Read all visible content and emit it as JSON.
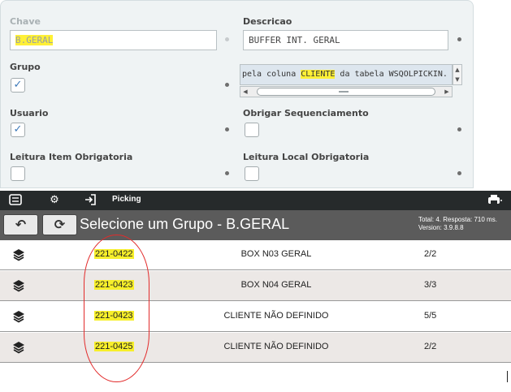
{
  "form": {
    "chave": {
      "label": "Chave",
      "value": "B.GERAL"
    },
    "descricao": {
      "label": "Descricao",
      "value": "BUFFER INT. GERAL"
    },
    "grupo": {
      "label": "Grupo",
      "checked": true
    },
    "memo": {
      "before": "pela coluna ",
      "highlight": "CLIENTE",
      "after": " da tabela WSQOLPICKIN."
    },
    "usuario": {
      "label": "Usuario",
      "checked": true
    },
    "obrigar_seq": {
      "label": "Obrigar Sequenciamento",
      "checked": false
    },
    "leitura_item": {
      "label": "Leitura Item Obrigatoria",
      "checked": false
    },
    "leitura_local": {
      "label": "Leitura Local Obrigatoria",
      "checked": false
    }
  },
  "toolbar": {
    "title": "Picking",
    "icons": [
      "menu-icon",
      "gear-icon",
      "logout-icon",
      "printer-icon"
    ]
  },
  "group_header": {
    "title": "Selecione um Grupo - B.GERAL",
    "total": "Total: 4. Resposta: 710 ms.",
    "version": "Version: 3.9.8.8"
  },
  "rows": [
    {
      "code": "221-0422",
      "description": "BOX  N03 GERAL",
      "qty": "2/2"
    },
    {
      "code": "221-0423",
      "description": "BOX  N04 GERAL",
      "qty": "3/3"
    },
    {
      "code": "221-0423",
      "description": "CLIENTE NÃO DEFINIDO",
      "qty": "5/5"
    },
    {
      "code": "221-0425",
      "description": "CLIENTE NÃO DEFINIDO",
      "qty": "2/2"
    }
  ],
  "colors": {
    "highlight": "#fff036",
    "toolbar_bg": "#262a2b",
    "header_bg": "#5b5b5b",
    "row_alt": "#ece8e6",
    "annotation": "#e22b2b"
  }
}
